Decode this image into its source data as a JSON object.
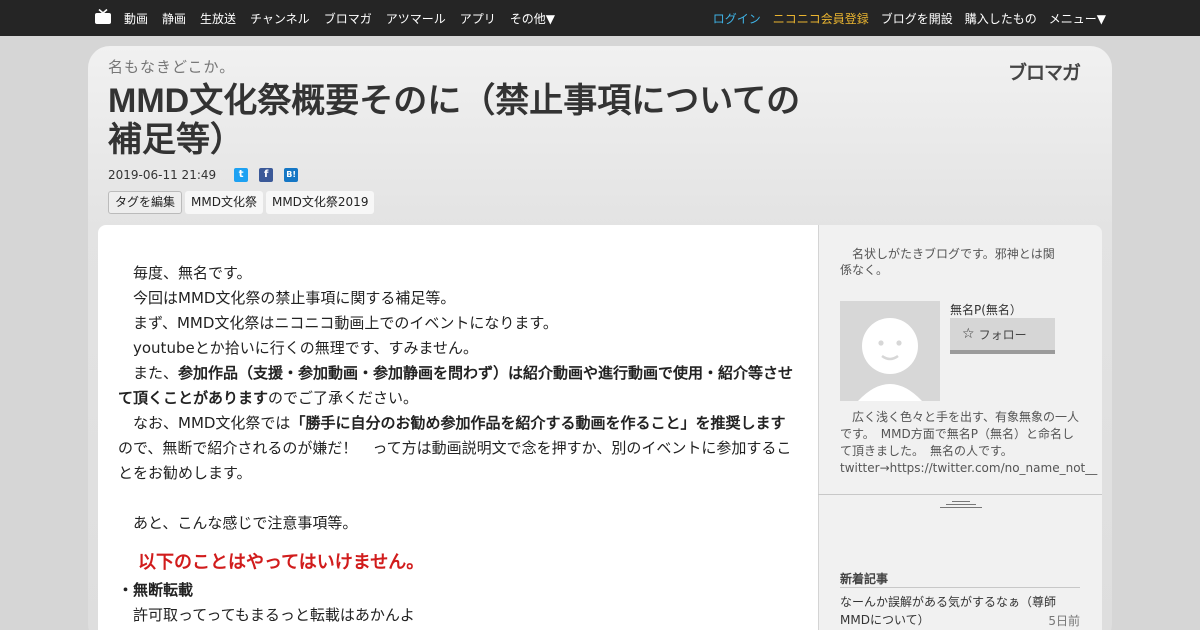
{
  "nav": {
    "left": [
      "動画",
      "静画",
      "生放送",
      "チャンネル",
      "ブロマガ",
      "アツマール",
      "アプリ",
      "その他▼"
    ],
    "login": "ログイン",
    "premium": "ニコニコ会員登録",
    "open_blog": "ブログを開設",
    "purchased": "購入したもの",
    "menu": "メニュー▼"
  },
  "blog": {
    "name": "名もなきどこか。",
    "logo": "ブロマガ"
  },
  "article": {
    "title": "MMD文化祭概要そのに（禁止事項についての補足等）",
    "date": "2019-06-11 21:49",
    "share": {
      "twitter": "t",
      "facebook": "f",
      "hatena": "B!"
    },
    "tags": [
      "タグを編集",
      "MMD文化祭",
      "MMD文化祭2019"
    ],
    "body": {
      "p1": "　毎度、無名です。",
      "p2": "　今回はMMD文化祭の禁止事項に関する補足等。",
      "p3": "　まず、MMD文化祭はニコニコ動画上でのイベントになります。",
      "p4": "　youtubeとか拾いに行くの無理です、すみません。",
      "p5_pre": "　また、",
      "p5_bold": "参加作品（支援・参加動画・参加静画を問わず）は紹介動画や進行動画で使用・紹介等させて頂くことがあります",
      "p5_post": "のでご了承ください。",
      "p6_pre": "　なお、MMD文化祭では",
      "p6_bold": "「勝手に自分のお勧め参加作品を紹介する動画を作ること」を推奨します",
      "p6_post": "ので、無断で紹介されるのが嫌だ！　って方は動画説明文で念を押すか、別のイベントに参加することをお勧めします。",
      "p7": "　あと、こんな感じで注意事項等。",
      "red_head": "以下のことはやってはいけません。",
      "item1": "・無断転載",
      "item1_note": "　許可取ってってもまるっと転載はあかんよ"
    }
  },
  "sidebar": {
    "desc": "　名状しがたきブログです。邪神とは関係なく。",
    "author": "無名P(無名）",
    "follow": "フォロー",
    "bio": "　広く浅く色々と手を出す、有象無象の一人です。　MMD方面で無名P（無名）と命名して頂きました。　無名の人です。 twitter→https://twitter.com/no_name_not__",
    "recent_title": "新着記事",
    "recent_item": "なーんか誤解がある気がするなぁ（尊師MMDについて）",
    "recent_date": "5日前"
  }
}
